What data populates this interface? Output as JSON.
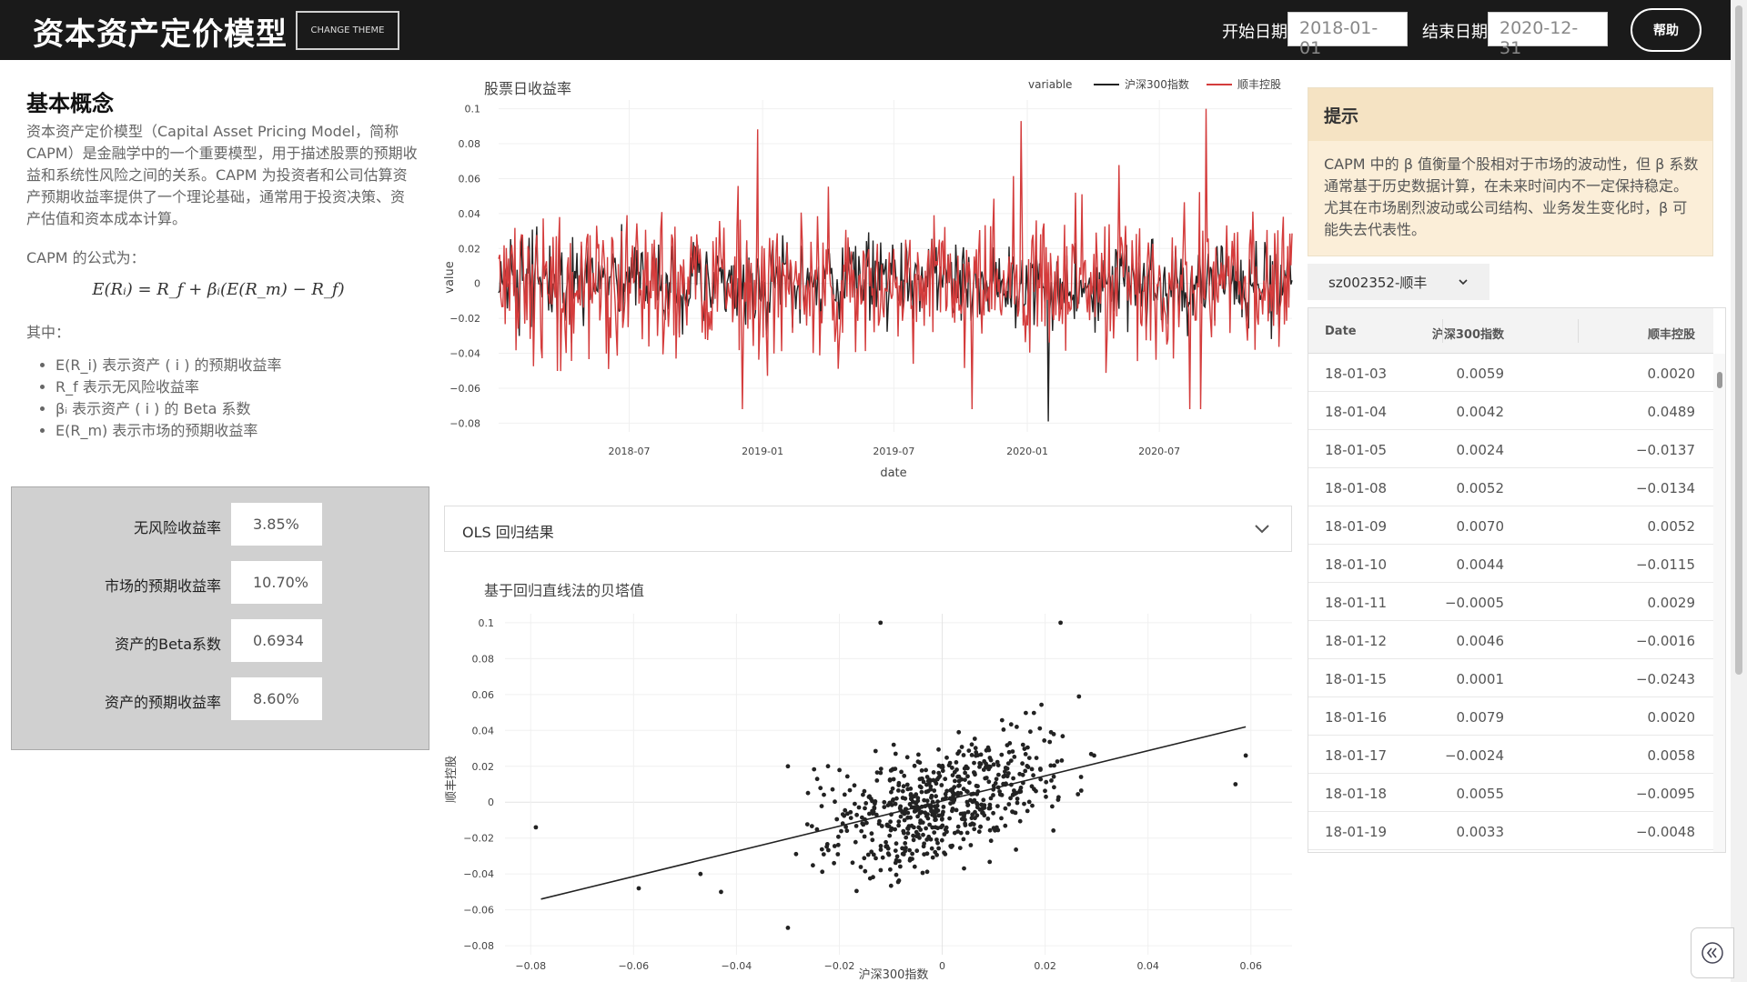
{
  "header": {
    "title": "资本资产定价模型",
    "theme_button": "CHANGE THEME",
    "start_label": "开始日期",
    "start_value": "2018-01-01",
    "end_label": "结束日期",
    "end_value": "2020-12-31",
    "help_button": "帮助"
  },
  "concept": {
    "title": "基本概念",
    "paragraph": "资本资产定价模型（Capital Asset Pricing Model，简称CAPM）是金融学中的一个重要模型，用于描述股票的预期收益和系统性风险之间的关系。CAPM 为投资者和公司估算资产预期收益率提供了一个理论基础，通常用于投资决策、资产估值和资本成本计算。",
    "formula_intro": "CAPM 的公式为：",
    "formula": "E(Rᵢ) = R_f + βᵢ(E(R_m) − R_f)",
    "where": "其中：",
    "defs": [
      "E(R_i) 表示资产 ( i ) 的预期收益率",
      "R_f 表示无风险收益率",
      "βᵢ 表示资产 ( i ) 的 Beta 系数",
      "E(R_m) 表示市场的预期收益率"
    ]
  },
  "params": [
    {
      "label": "无风险收益率",
      "value": "3.85%"
    },
    {
      "label": "市场的预期收益率",
      "value": "10.70%"
    },
    {
      "label": "资产的Beta系数",
      "value": "0.6934"
    },
    {
      "label": "资产的预期收益率",
      "value": "8.60%"
    }
  ],
  "line_chart": {
    "title": "股票日收益率",
    "legend_title": "variable",
    "series_names": [
      "沪深300指数",
      "顺丰控股"
    ],
    "colors": [
      "#222222",
      "#d43c3c"
    ],
    "ylabel": "value",
    "xlabel": "date",
    "yticks": [
      "0.1",
      "0.08",
      "0.06",
      "0.04",
      "0.02",
      "0",
      "−0.02",
      "−0.04",
      "−0.06",
      "−0.08"
    ],
    "xticks": [
      "2018-07",
      "2019-01",
      "2019-07",
      "2020-01",
      "2020-07"
    ]
  },
  "ols": {
    "label": "OLS 回归结果"
  },
  "scatter_chart": {
    "title": "基于回归直线法的贝塔值",
    "xlabel": "沪深300指数",
    "ylabel": "顺丰控股",
    "yticks": [
      "0.1",
      "0.08",
      "0.06",
      "0.04",
      "0.02",
      "0",
      "−0.02",
      "−0.04",
      "−0.06",
      "−0.08"
    ],
    "xticks": [
      "−0.08",
      "−0.06",
      "−0.04",
      "−0.02",
      "0",
      "0.02",
      "0.04",
      "0.06"
    ]
  },
  "chart_data": [
    {
      "type": "line",
      "title": "股票日收益率",
      "xlabel": "date",
      "ylabel": "value",
      "ylim": [
        -0.085,
        0.105
      ],
      "x_range": [
        "2018-01-02",
        "2020-12-31"
      ],
      "series": [
        {
          "name": "沪深300指数",
          "note": "daily returns ~730 trading days, typically within ±0.03, min about -0.079 near 2020-02"
        },
        {
          "name": "顺丰控股",
          "note": "daily returns ~730 trading days, typically within ±0.05, max about 0.10 near 2020-08"
        }
      ]
    },
    {
      "type": "scatter",
      "title": "基于回归直线法的贝塔值",
      "xlabel": "沪深300指数",
      "ylabel": "顺丰控股",
      "xlim": [
        -0.085,
        0.068
      ],
      "ylim": [
        -0.085,
        0.105
      ],
      "regression_line": {
        "x": [
          -0.078,
          0.059
        ],
        "y": [
          -0.054,
          0.042
        ]
      },
      "outliers": [
        {
          "x": -0.079,
          "y": -0.014
        },
        {
          "x": -0.059,
          "y": -0.048
        },
        {
          "x": -0.047,
          "y": -0.04
        },
        {
          "x": -0.043,
          "y": -0.05
        },
        {
          "x": -0.03,
          "y": -0.07
        },
        {
          "x": -0.03,
          "y": 0.02
        },
        {
          "x": -0.012,
          "y": 0.1
        },
        {
          "x": 0.023,
          "y": 0.1
        },
        {
          "x": 0.057,
          "y": 0.01
        },
        {
          "x": 0.059,
          "y": 0.026
        }
      ]
    }
  ],
  "tip": {
    "title": "提示",
    "body": "CAPM 中的 β 值衡量个股相对于市场的波动性，但 β 系数通常基于历史数据计算，在未来时间内不一定保持稳定。尤其在市场剧烈波动或公司结构、业务发生变化时，β 可能失去代表性。"
  },
  "stock_select": {
    "value": "sz002352-顺丰"
  },
  "table": {
    "columns": [
      "Date",
      "沪深300指数",
      "顺丰控股"
    ],
    "rows": [
      [
        "18-01-03",
        "0.0059",
        "0.0020"
      ],
      [
        "18-01-04",
        "0.0042",
        "0.0489"
      ],
      [
        "18-01-05",
        "0.0024",
        "−0.0137"
      ],
      [
        "18-01-08",
        "0.0052",
        "−0.0134"
      ],
      [
        "18-01-09",
        "0.0070",
        "0.0052"
      ],
      [
        "18-01-10",
        "0.0044",
        "−0.0115"
      ],
      [
        "18-01-11",
        "−0.0005",
        "0.0029"
      ],
      [
        "18-01-12",
        "0.0046",
        "−0.0016"
      ],
      [
        "18-01-15",
        "0.0001",
        "−0.0243"
      ],
      [
        "18-01-16",
        "0.0079",
        "0.0020"
      ],
      [
        "18-01-17",
        "−0.0024",
        "0.0058"
      ],
      [
        "18-01-18",
        "0.0055",
        "−0.0095"
      ],
      [
        "18-01-19",
        "0.0033",
        "−0.0048"
      ]
    ]
  }
}
